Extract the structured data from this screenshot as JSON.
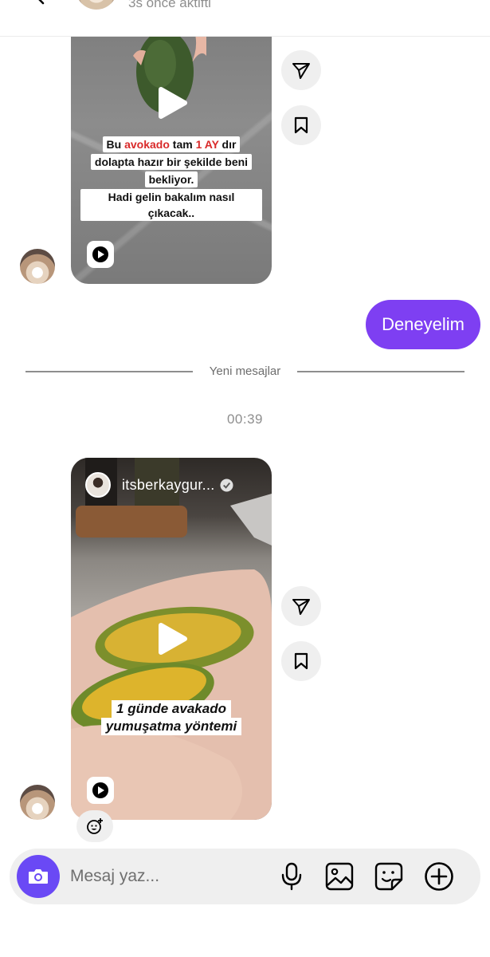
{
  "header": {
    "status": "3s önce aktifti",
    "icons": [
      "back-icon",
      "phone-icon",
      "video-icon",
      "info-icon"
    ]
  },
  "messages": {
    "reel1": {
      "caption_lines": [
        [
          "Bu ",
          "avokado",
          " tam ",
          "1 AY",
          " dır"
        ],
        [
          "dolapta hazır bir şekilde beni"
        ],
        [
          "bekliyor."
        ],
        [
          "Hadi gelin bakalım nasıl çıkacak.."
        ]
      ]
    },
    "outgoing": {
      "text": "Deneyelim"
    },
    "divider": {
      "text": "Yeni mesajlar"
    },
    "timestamp": "00:39",
    "reel2": {
      "author": "itsberkaygur...",
      "caption_lines": [
        "1 günde avakado",
        "yumuşatma yöntemi"
      ]
    }
  },
  "composer": {
    "placeholder": "Mesaj yaz...",
    "icons": [
      "camera-icon",
      "microphone-icon",
      "gallery-icon",
      "sticker-icon",
      "plus-icon"
    ]
  },
  "colors": {
    "accent": "#7e3ff2",
    "camera": "#6a49f5",
    "caption_red": "#d92a2a"
  }
}
